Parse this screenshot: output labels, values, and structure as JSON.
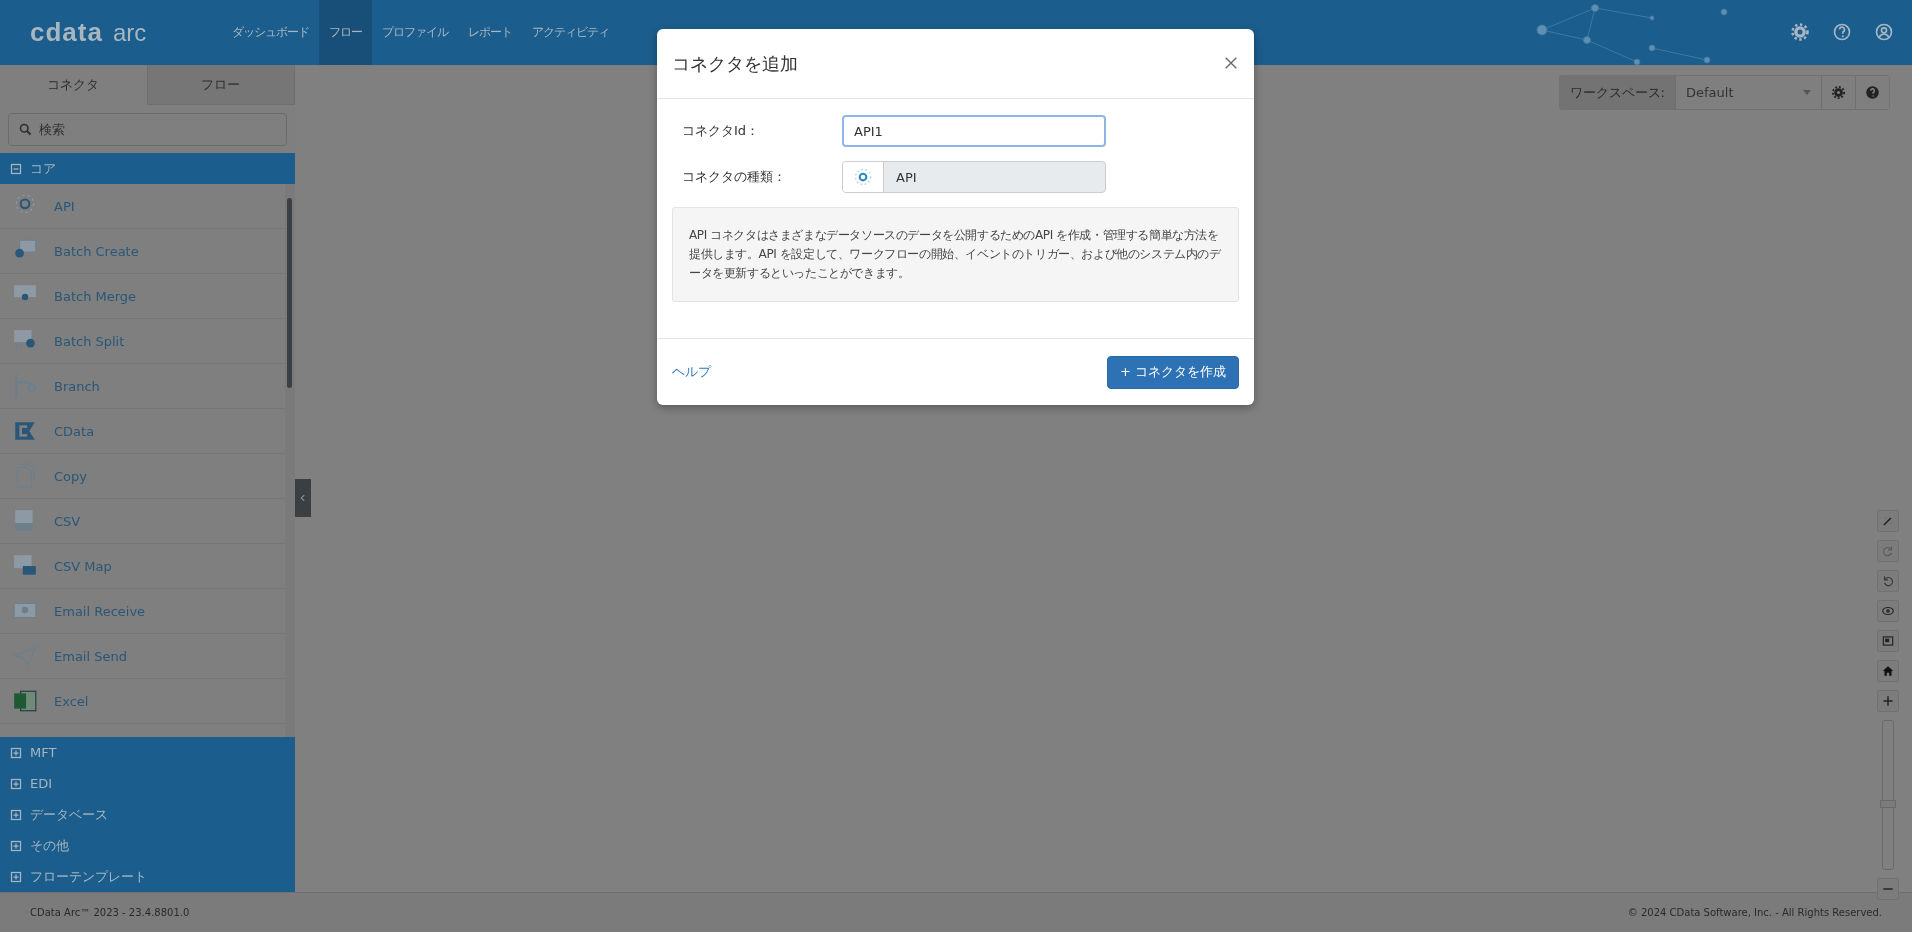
{
  "logo": {
    "brand": "cdata",
    "product": "arc"
  },
  "nav": [
    {
      "label": "ダッシュボード",
      "selected": false
    },
    {
      "label": "フロー",
      "selected": true
    },
    {
      "label": "プロファイル",
      "selected": false
    },
    {
      "label": "レポート",
      "selected": false
    },
    {
      "label": "アクティビティ",
      "selected": false
    }
  ],
  "sidebar": {
    "tabs": [
      {
        "label": "コネクタ",
        "selected": true
      },
      {
        "label": "フロー",
        "selected": false
      }
    ],
    "search": {
      "placeholder": "検索"
    },
    "categories": [
      {
        "label": "コア",
        "expanded": true,
        "connectors": [
          "API",
          "Batch Create",
          "Batch Merge",
          "Batch Split",
          "Branch",
          "CData",
          "Copy",
          "CSV",
          "CSV Map",
          "Email Receive",
          "Email Send",
          "Excel"
        ]
      },
      {
        "label": "MFT",
        "expanded": false
      },
      {
        "label": "EDI",
        "expanded": false
      },
      {
        "label": "データベース",
        "expanded": false
      },
      {
        "label": "その他",
        "expanded": false
      },
      {
        "label": "フローテンプレート",
        "expanded": false
      }
    ]
  },
  "workspace": {
    "label": "ワークスペース:",
    "value": "Default"
  },
  "zoom": {
    "level": 0.44
  },
  "dialog": {
    "title": "コネクタを追加",
    "id_label": "コネクタId：",
    "id_value": "API1",
    "type_label": "コネクタの種類：",
    "type_value": "API",
    "description": "API コネクタはさまざまなデータソースのデータを公開するためのAPI を作成・管理する簡単な方法を提供します。API を設定して、ワークフローの開始、イベントのトリガー、および他のシステム内のデータを更新するといったことができます。",
    "help_link": "ヘルプ",
    "create_button": "+ コネクタを作成"
  },
  "footer": {
    "version": "CData Arc™ 2023 - 23.4.8801.0",
    "copyright": "© 2024 CData Software, Inc. - All Rights Reserved."
  }
}
